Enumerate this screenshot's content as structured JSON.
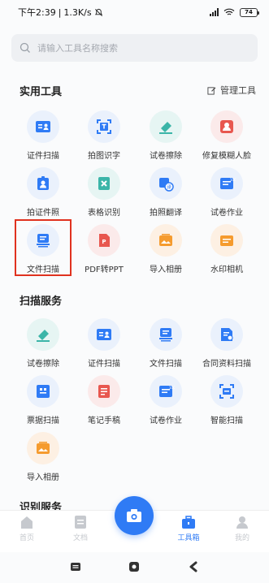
{
  "status": {
    "time": "下午2:39",
    "speed": "1.3K/s",
    "battery": "74"
  },
  "search": {
    "placeholder": "请输入工具名称搜索"
  },
  "sections": {
    "practical": "实用工具",
    "manage": "管理工具",
    "scan": "扫描服务",
    "recognize": "识别服务"
  },
  "practical_items": [
    {
      "label": "证件扫描",
      "icon": "id-card-icon"
    },
    {
      "label": "拍图识字",
      "icon": "text-recognition-icon"
    },
    {
      "label": "试卷擦除",
      "icon": "eraser-icon"
    },
    {
      "label": "修复模糊人脸",
      "icon": "face-repair-icon"
    },
    {
      "label": "拍证件照",
      "icon": "id-photo-icon"
    },
    {
      "label": "表格识别",
      "icon": "table-recognition-icon"
    },
    {
      "label": "拍照翻译",
      "icon": "translate-icon"
    },
    {
      "label": "试卷作业",
      "icon": "homework-icon"
    },
    {
      "label": "文件扫描",
      "icon": "document-scan-icon"
    },
    {
      "label": "PDF转PPT",
      "icon": "pdf-to-ppt-icon"
    },
    {
      "label": "导入相册",
      "icon": "import-album-icon"
    },
    {
      "label": "水印相机",
      "icon": "watermark-camera-icon"
    }
  ],
  "scan_items": [
    {
      "label": "试卷擦除",
      "icon": "eraser-icon"
    },
    {
      "label": "证件扫描",
      "icon": "id-card-icon"
    },
    {
      "label": "文件扫描",
      "icon": "document-scan-icon"
    },
    {
      "label": "合同资料扫描",
      "icon": "contract-scan-icon"
    },
    {
      "label": "票据扫描",
      "icon": "receipt-scan-icon"
    },
    {
      "label": "笔记手稿",
      "icon": "notes-icon"
    },
    {
      "label": "试卷作业",
      "icon": "homework-icon"
    },
    {
      "label": "智能扫描",
      "icon": "smart-scan-icon"
    },
    {
      "label": "导入相册",
      "icon": "import-album-icon"
    }
  ],
  "tabs": [
    {
      "label": "首页"
    },
    {
      "label": "文档"
    },
    {
      "label": "工具箱"
    },
    {
      "label": "我的"
    }
  ],
  "colors": {
    "accent": "#2f7bf5",
    "highlight": "#e0321f",
    "orange": "#f59b2e",
    "red": "#e8574f",
    "teal": "#3bb5a8"
  }
}
